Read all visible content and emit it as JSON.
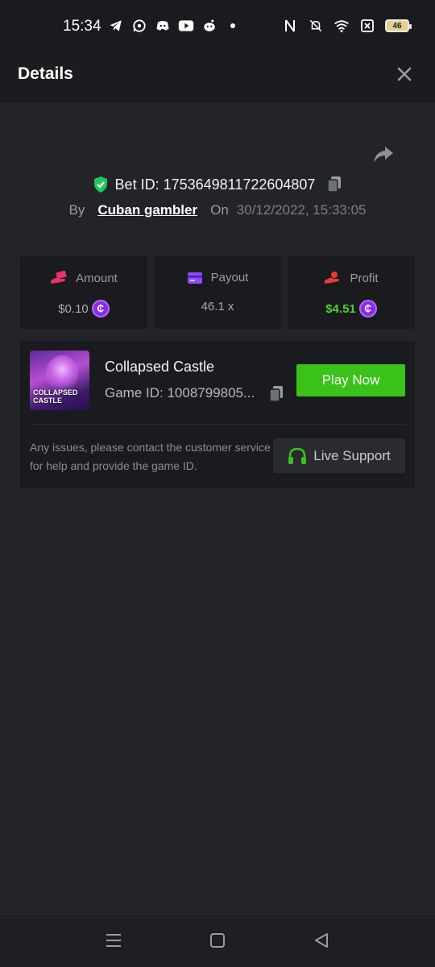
{
  "status_bar": {
    "time": "15:34",
    "left_icons": [
      "telegram-icon",
      "whatsapp-icon",
      "discord-icon",
      "youtube-icon",
      "reddit-icon",
      "dot-icon"
    ],
    "right_icons": [
      "nfc-icon",
      "bell-muted-icon",
      "wifi-icon",
      "sim-x-icon",
      "battery-icon"
    ],
    "battery": "46"
  },
  "header": {
    "title": "Details",
    "close_icon": "close-icon"
  },
  "bet": {
    "id_label": "Bet ID: 1753649811722604807",
    "by_label": "By",
    "user": "Cuban gambler",
    "on_label": "On",
    "date": "30/12/2022, 15:33:05"
  },
  "stats": {
    "amount": {
      "title": "Amount",
      "value": "$0.10",
      "icon": "money-hand-icon",
      "color": "#e8336a"
    },
    "payout": {
      "title": "Payout",
      "value": "46.1 x",
      "icon": "card-icon",
      "color": "#8a4dff"
    },
    "profit": {
      "title": "Profit",
      "value": "$4.51",
      "icon": "profit-hand-icon",
      "color": "#e83a3a"
    }
  },
  "game": {
    "thumb_text": "COLLAPSED CASTLE",
    "name": "Collapsed Castle",
    "id_label": "Game ID: 1008799805...",
    "play_label": "Play Now",
    "issue_text": "Any issues, please contact the customer service for help and provide the game ID.",
    "support_label": "Live Support"
  },
  "colors": {
    "background": "#232428",
    "card": "#1a1b1e",
    "accent_green": "#3bc21a",
    "coin_purple": "#8b2be2"
  }
}
